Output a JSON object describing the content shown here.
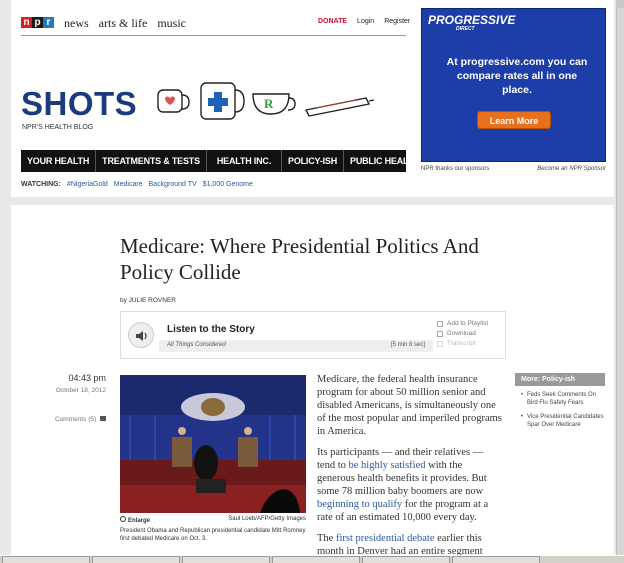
{
  "topnav": {
    "news": "news",
    "arts": "arts & life",
    "music": "music"
  },
  "util": {
    "donate": "DONATE",
    "login": "Login",
    "register": "Register"
  },
  "blog": {
    "title": "SHOTS",
    "tagline": "NPR'S HEALTH BLOG"
  },
  "sections": [
    "YOUR HEALTH",
    "TREATMENTS & TESTS",
    "HEALTH INC.",
    "POLICY-ISH",
    "PUBLIC HEALTH"
  ],
  "watching": {
    "label": "WATCHING:",
    "items": [
      "#NigeriaGold",
      "Medicare",
      "Background TV",
      "$1,000 Genome"
    ]
  },
  "ad": {
    "brand": "PROGRESSIVE",
    "brand_sub": "DIRECT",
    "copy": "At progressive.com you can compare rates all in one place.",
    "button": "Learn More",
    "thanks": "NPR thanks our sponsors",
    "become": "Become an NPR Sponsor"
  },
  "article": {
    "headline": "Medicare: Where Presidential Politics And Policy Collide",
    "byline": "by JULIE ROVNER",
    "time": "04:43 pm",
    "date": "October 18, 2012",
    "comments": "Comments (5)",
    "p1": "Medicare, the federal health insurance program for about 50 million senior and disabled Americans, is simultaneously one of the most popular and imperiled programs in America.",
    "p2a": "Its participants — and their relatives — tend to ",
    "p2link1": "be highly satisfied",
    "p2b": " with the generous health benefits it provides. But some 78 million baby boomers are now ",
    "p2link2": "beginning to qualify",
    "p2c": " for the program at a rate of an estimated 10,000 every day.",
    "p3a": "The ",
    "p3link": "first presidential debate",
    "p3b": " earlier this month in Denver had an entire segment"
  },
  "player": {
    "title": "Listen to the Story",
    "program": "All Things Considered",
    "length": "[5 min 8 sec]",
    "actions": [
      "Add to Playlist",
      "Download",
      "Transcript"
    ]
  },
  "photo": {
    "enlarge": "Enlarge",
    "credit": "Saul Loeb/AFP/Getty Images",
    "caption": "President Obama and Republican presidential candidate Mitt Romney first debated Medicare on Oct. 3."
  },
  "more": {
    "header": "More: Policy-ish",
    "items": [
      "Feds Seek Comments On Bird Flu Safety Fears",
      "Vice Presidential Candidates Spar Over Medicare"
    ]
  }
}
